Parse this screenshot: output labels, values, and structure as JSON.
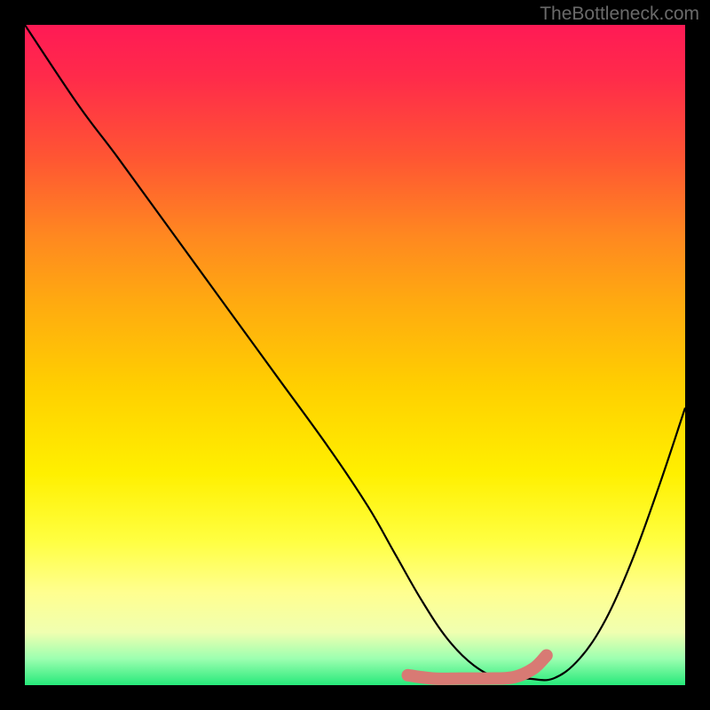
{
  "watermark": "TheBottleneck.com",
  "chart_data": {
    "type": "line",
    "title": "",
    "xlabel": "",
    "ylabel": "",
    "xlim": [
      0,
      100
    ],
    "ylim": [
      0,
      100
    ],
    "series": [
      {
        "name": "black-curve",
        "x": [
          0,
          8,
          14,
          22,
          30,
          38,
          46,
          52,
          56,
          60,
          64,
          68,
          72,
          76,
          80,
          84,
          88,
          92,
          96,
          100
        ],
        "values": [
          100,
          88,
          80,
          69,
          58,
          47,
          36,
          27,
          20,
          13,
          7,
          3,
          1,
          1,
          1,
          4,
          10,
          19,
          30,
          42
        ]
      },
      {
        "name": "pink-curve-segment",
        "x": [
          58,
          62,
          66,
          70,
          74,
          77,
          79
        ],
        "values": [
          1.5,
          1.0,
          1.0,
          1.0,
          1.2,
          2.5,
          4.5
        ]
      }
    ],
    "colors": {
      "black_curve": "#000000",
      "pink_curve": "#d87a74",
      "gradient_top": "#ff1a55",
      "gradient_bottom": "#26e97a"
    }
  }
}
